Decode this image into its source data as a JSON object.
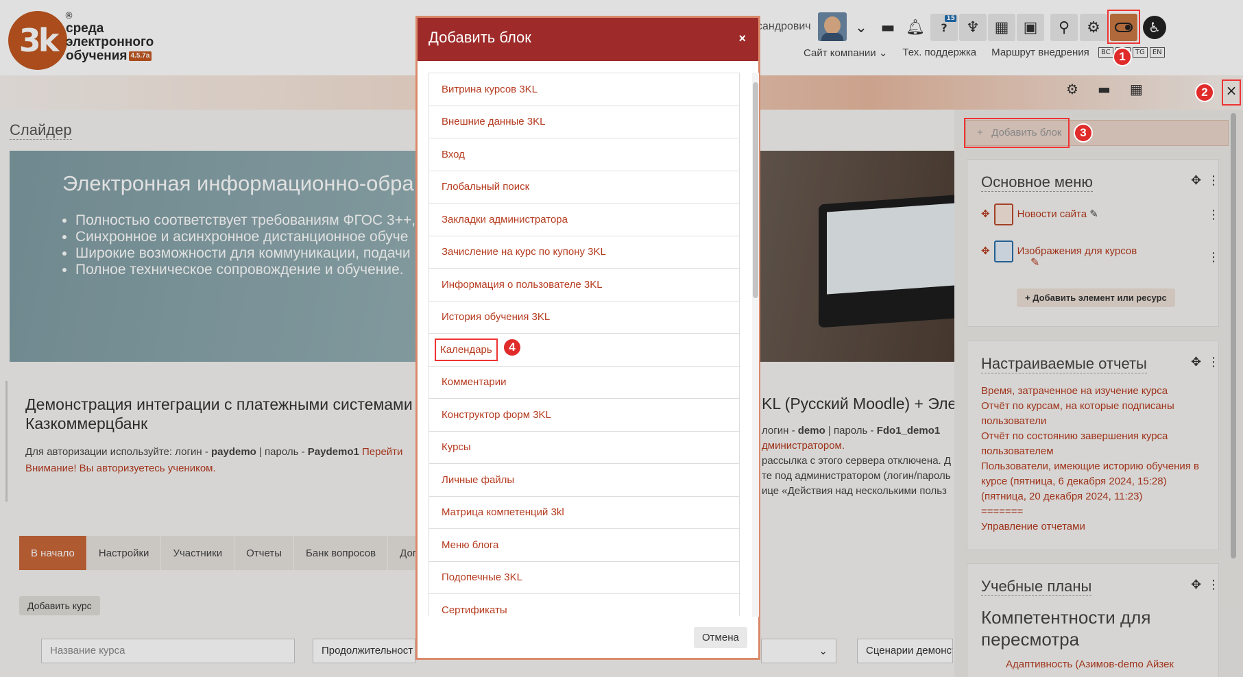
{
  "header": {
    "logo_lines": [
      "среда",
      "электронного",
      "обучения"
    ],
    "logo_mark": "3k",
    "version": "4.5.7a",
    "username": "сандрович",
    "nav_links": [
      "Сайт компании ⌄",
      "Тех. поддержка",
      "Маршрут внедрения"
    ],
    "languages": [
      "BC",
      "RU",
      "TG",
      "EN"
    ],
    "help_badge": "15",
    "icons": [
      "chevron-down-icon",
      "chat-icon",
      "bell-icon",
      "help-icon",
      "trophy-icon",
      "dashboard-icon",
      "user-card-icon",
      "search-icon",
      "gear-icon",
      "edit-mode-toggle-icon",
      "accessibility-icon"
    ]
  },
  "main": {
    "slider_title": "Слайдер",
    "slider_heading": "Электронная информационно-обра",
    "slider_points": [
      "Полностью соответствует требованиям ФГОС 3++,",
      "Синхронное и асинхронное дистанционное обуче",
      "Широкие возможности для коммуникации, подачи",
      "Полное техническое сопровождение и обучение."
    ],
    "course_title_left": "Демонстрация интеграции с платежными системами К Казкоммерцбанк",
    "course_title_right": "KL (Русский Moodle) + Элект",
    "auth_line_prefix": "Для авторизации используйте: логин - ",
    "auth_login": "paydemo",
    "auth_line_mid": " | пароль - ",
    "auth_password": "Paydemo1",
    "auth_more": " Перейти",
    "warning": "Внимание! Вы авторизуетесь учеником.",
    "right_line1_prefix": "логин - ",
    "right_login": "demo",
    "right_mid": " | пароль - ",
    "right_password": "Fdo1_demo1",
    "right_line2": "дминистратором.",
    "right_line3": " рассылка с этого сервера отключена. Д",
    "right_line4": "те под администратором (логин/пароль",
    "right_line5": "ице «Действия над несколькими польз",
    "tabs": [
      "В начало",
      "Настройки",
      "Участники",
      "Отчеты",
      "Банк вопросов",
      "Доп"
    ],
    "add_course": "Добавить курс",
    "filters": [
      "Название курса",
      "Продолжительност",
      "⌄",
      "Сценарии демонст"
    ]
  },
  "drawer": {
    "add_block": "Добавить блок",
    "main_menu_title": "Основное меню",
    "menu_items": [
      "Новости сайта",
      "Изображения для курсов"
    ],
    "add_resource": "Добавить элемент или ресурс",
    "reports_title": "Настраиваемые отчеты",
    "reports": [
      "Время, затраченное на изучение курса",
      "Отчёт по курсам, на которые подписаны пользователи",
      "Отчёт по состоянию завершения курса пользователем",
      "Пользователи, имеющие историю обучения в курсе (пятница, 6 декабря 2024, 15:28) (пятница, 20 декабря 2024, 11:23)",
      "=======",
      "Управление отчетами"
    ],
    "plans_title": "Учебные планы",
    "competencies_title": "Компетентности для пересмотра",
    "competency_item": "Адаптивность (Азимов-demo Айзек"
  },
  "modal": {
    "title": "Добавить блок",
    "close": "×",
    "items": [
      "Витрина курсов 3KL",
      "Внешние данные 3KL",
      "Вход",
      "Глобальный поиск",
      "Закладки администратора",
      "Зачисление на курс по купону 3KL",
      "Информация о пользователе 3KL",
      "История обучения 3KL",
      "Календарь",
      "Комментарии",
      "Конструктор форм 3KL",
      "Курсы",
      "Личные файлы",
      "Матрица компетенций 3kl",
      "Меню блога",
      "Подопечные 3KL",
      "Сертификаты"
    ],
    "cancel": "Отмена"
  },
  "annotations": [
    "1",
    "2",
    "3",
    "4"
  ],
  "colors": {
    "accent": "#c9673a",
    "modal_header": "#9e2a2a",
    "link": "#b53b1f",
    "marker": "#e02b2b"
  }
}
